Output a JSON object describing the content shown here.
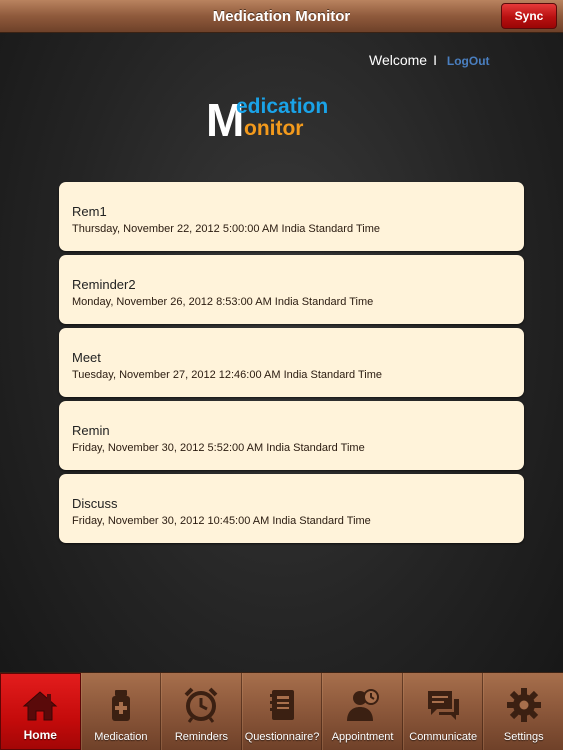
{
  "header": {
    "title": "Medication Monitor",
    "sync_label": "Sync"
  },
  "user": {
    "welcome": "Welcome",
    "separator": "I",
    "logout": "LogOut"
  },
  "logo": {
    "line1": "edication",
    "line2": "onitor",
    "letter": "M"
  },
  "reminders": [
    {
      "name": "Rem1",
      "date": "Thursday, November 22, 2012 5:00:00 AM India Standard Time"
    },
    {
      "name": "Reminder2",
      "date": "Monday, November 26, 2012 8:53:00 AM India Standard Time"
    },
    {
      "name": "Meet",
      "date": "Tuesday, November 27, 2012 12:46:00 AM India Standard Time"
    },
    {
      "name": "Remin",
      "date": "Friday, November 30, 2012 5:52:00 AM India Standard Time"
    },
    {
      "name": "Discuss",
      "date": "Friday, November 30, 2012 10:45:00 AM India Standard Time"
    }
  ],
  "tabs": [
    {
      "label": "Home",
      "icon": "home-icon",
      "active": true
    },
    {
      "label": "Medication",
      "icon": "medicine-bottle-icon"
    },
    {
      "label": "Reminders",
      "icon": "alarm-clock-icon"
    },
    {
      "label": "Questionnaire?",
      "icon": "notebook-icon"
    },
    {
      "label": "Appointment",
      "icon": "person-clock-icon"
    },
    {
      "label": "Communicate",
      "icon": "speech-bubbles-icon"
    },
    {
      "label": "Settings",
      "icon": "gear-icon"
    }
  ],
  "colors": {
    "accent_red": "#c50b0b",
    "card_bg": "#fff3da",
    "logo_blue": "#1aa3e8",
    "logo_orange": "#f39a1c",
    "link_blue": "#4a7fc0"
  }
}
